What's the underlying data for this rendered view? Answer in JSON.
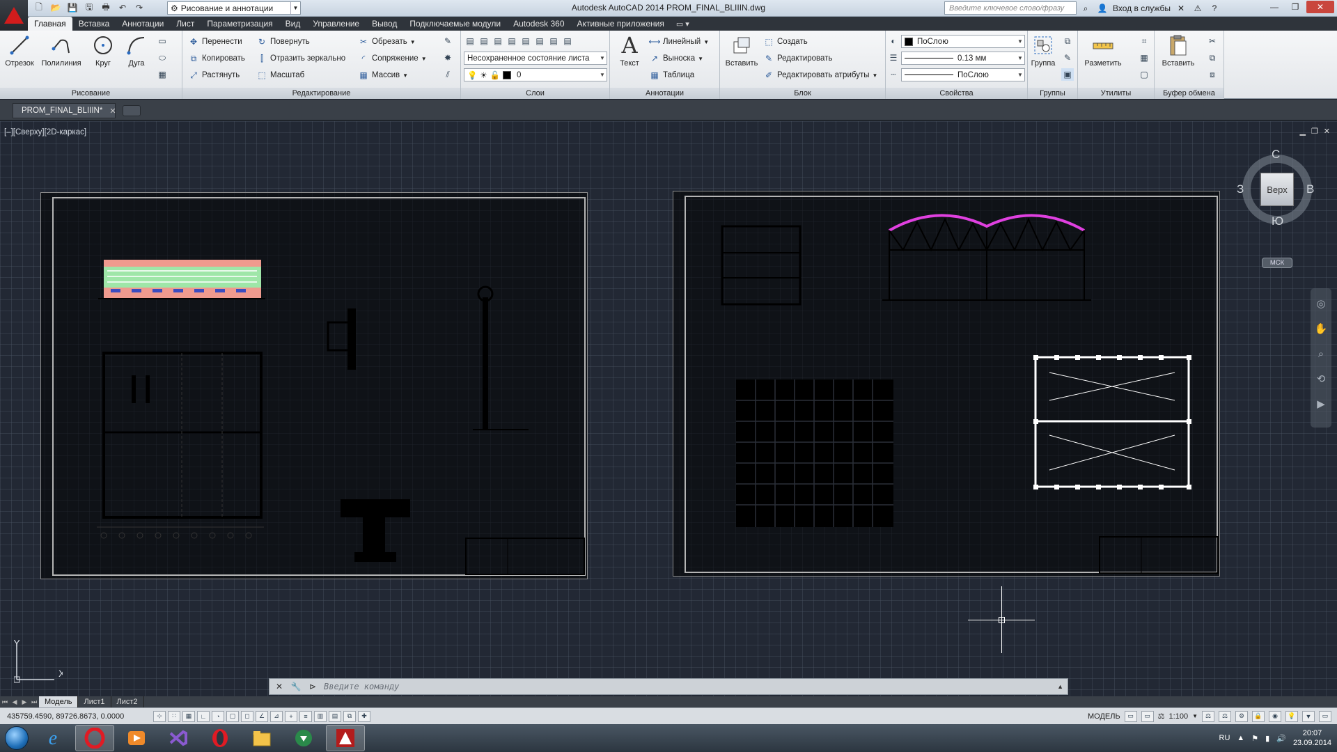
{
  "titlebar": {
    "workspace": "Рисование и аннотации",
    "title": "Autodesk AutoCAD 2014   PROM_FINAL_BLIIIN.dwg",
    "search_placeholder": "Введите ключевое слово/фразу",
    "signin": "Вход в службы"
  },
  "ribbon_tabs": [
    "Главная",
    "Вставка",
    "Аннотации",
    "Лист",
    "Параметризация",
    "Вид",
    "Управление",
    "Вывод",
    "Подключаемые модули",
    "Autodesk 360",
    "Активные приложения"
  ],
  "ribbon": {
    "draw": {
      "title": "Рисование",
      "line": "Отрезок",
      "polyline": "Полилиния",
      "circle": "Круг",
      "arc": "Дуга"
    },
    "modify": {
      "title": "Редактирование",
      "move": "Перенести",
      "rotate": "Повернуть",
      "trim": "Обрезать",
      "copy": "Копировать",
      "mirror": "Отразить зеркально",
      "fillet": "Сопряжение",
      "stretch": "Растянуть",
      "scale": "Масштаб",
      "array": "Массив"
    },
    "layers": {
      "title": "Слои",
      "state": "Несохраненное состояние листа",
      "current_layer": "0"
    },
    "annotation": {
      "title": "Аннотации",
      "text": "Текст",
      "linear": "Линейный",
      "leader": "Выноска",
      "table": "Таблица"
    },
    "block": {
      "title": "Блок",
      "insert": "Вставить",
      "create": "Создать",
      "edit": "Редактировать",
      "edit_attr": "Редактировать атрибуты"
    },
    "properties": {
      "title": "Свойства",
      "color": "ПоСлою",
      "lineweight": "0.13 мм",
      "linetype": "ПоСлою"
    },
    "groups": {
      "title": "Группы",
      "group": "Группа"
    },
    "utilities": {
      "title": "Утилиты",
      "measure": "Разметить"
    },
    "clipboard": {
      "title": "Буфер обмена",
      "paste": "Вставить"
    }
  },
  "filetab": {
    "name": "PROM_FINAL_BLIIIN*"
  },
  "viewport": {
    "label": "[–][Сверху][2D-каркас]",
    "viewcube": {
      "face": "Верх",
      "north": "С",
      "south": "Ю",
      "east": "В",
      "west": "З"
    },
    "ucs_label": "МСК"
  },
  "command": {
    "placeholder": "Введите команду"
  },
  "layout_tabs": [
    "Модель",
    "Лист1",
    "Лист2"
  ],
  "status": {
    "coords": "435759.4590, 89726.8673, 0.0000",
    "mode": "МОДЕЛЬ",
    "scale": "1:100"
  },
  "taskbar": {
    "lang": "RU",
    "time": "20:07",
    "date": "23.09.2014"
  },
  "colors": {
    "canvas": "#222834",
    "accent_red": "#d21c1c",
    "truss_magenta": "#e040e0"
  }
}
